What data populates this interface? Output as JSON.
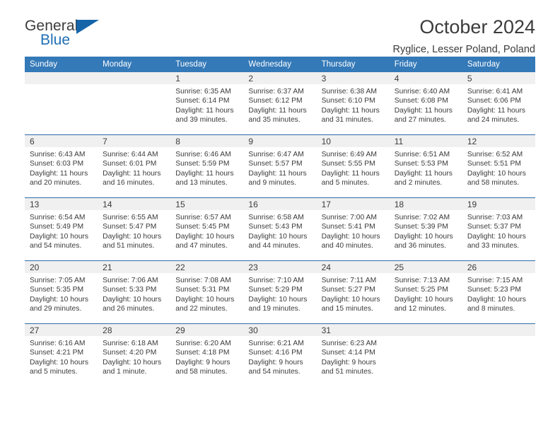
{
  "brand": {
    "line1": "General",
    "line2": "Blue",
    "triangle_color": "#1565a8",
    "blue_color": "#1f6fb5"
  },
  "header": {
    "title": "October 2024",
    "subtitle": "Ryglice, Lesser Poland, Poland"
  },
  "theme": {
    "header_row_bg": "#3479b8",
    "row_divider": "#2f6ca8",
    "daynum_bg": "#f0f0f0",
    "text": "#3b3b3b"
  },
  "calendar": {
    "weekday_headers": [
      "Sunday",
      "Monday",
      "Tuesday",
      "Wednesday",
      "Thursday",
      "Friday",
      "Saturday"
    ],
    "weeks": [
      [
        {
          "day": "",
          "sunrise": "",
          "sunset": "",
          "daylight1": "",
          "daylight2": ""
        },
        {
          "day": "",
          "sunrise": "",
          "sunset": "",
          "daylight1": "",
          "daylight2": ""
        },
        {
          "day": "1",
          "sunrise": "Sunrise: 6:35 AM",
          "sunset": "Sunset: 6:14 PM",
          "daylight1": "Daylight: 11 hours",
          "daylight2": "and 39 minutes."
        },
        {
          "day": "2",
          "sunrise": "Sunrise: 6:37 AM",
          "sunset": "Sunset: 6:12 PM",
          "daylight1": "Daylight: 11 hours",
          "daylight2": "and 35 minutes."
        },
        {
          "day": "3",
          "sunrise": "Sunrise: 6:38 AM",
          "sunset": "Sunset: 6:10 PM",
          "daylight1": "Daylight: 11 hours",
          "daylight2": "and 31 minutes."
        },
        {
          "day": "4",
          "sunrise": "Sunrise: 6:40 AM",
          "sunset": "Sunset: 6:08 PM",
          "daylight1": "Daylight: 11 hours",
          "daylight2": "and 27 minutes."
        },
        {
          "day": "5",
          "sunrise": "Sunrise: 6:41 AM",
          "sunset": "Sunset: 6:06 PM",
          "daylight1": "Daylight: 11 hours",
          "daylight2": "and 24 minutes."
        }
      ],
      [
        {
          "day": "6",
          "sunrise": "Sunrise: 6:43 AM",
          "sunset": "Sunset: 6:03 PM",
          "daylight1": "Daylight: 11 hours",
          "daylight2": "and 20 minutes."
        },
        {
          "day": "7",
          "sunrise": "Sunrise: 6:44 AM",
          "sunset": "Sunset: 6:01 PM",
          "daylight1": "Daylight: 11 hours",
          "daylight2": "and 16 minutes."
        },
        {
          "day": "8",
          "sunrise": "Sunrise: 6:46 AM",
          "sunset": "Sunset: 5:59 PM",
          "daylight1": "Daylight: 11 hours",
          "daylight2": "and 13 minutes."
        },
        {
          "day": "9",
          "sunrise": "Sunrise: 6:47 AM",
          "sunset": "Sunset: 5:57 PM",
          "daylight1": "Daylight: 11 hours",
          "daylight2": "and 9 minutes."
        },
        {
          "day": "10",
          "sunrise": "Sunrise: 6:49 AM",
          "sunset": "Sunset: 5:55 PM",
          "daylight1": "Daylight: 11 hours",
          "daylight2": "and 5 minutes."
        },
        {
          "day": "11",
          "sunrise": "Sunrise: 6:51 AM",
          "sunset": "Sunset: 5:53 PM",
          "daylight1": "Daylight: 11 hours",
          "daylight2": "and 2 minutes."
        },
        {
          "day": "12",
          "sunrise": "Sunrise: 6:52 AM",
          "sunset": "Sunset: 5:51 PM",
          "daylight1": "Daylight: 10 hours",
          "daylight2": "and 58 minutes."
        }
      ],
      [
        {
          "day": "13",
          "sunrise": "Sunrise: 6:54 AM",
          "sunset": "Sunset: 5:49 PM",
          "daylight1": "Daylight: 10 hours",
          "daylight2": "and 54 minutes."
        },
        {
          "day": "14",
          "sunrise": "Sunrise: 6:55 AM",
          "sunset": "Sunset: 5:47 PM",
          "daylight1": "Daylight: 10 hours",
          "daylight2": "and 51 minutes."
        },
        {
          "day": "15",
          "sunrise": "Sunrise: 6:57 AM",
          "sunset": "Sunset: 5:45 PM",
          "daylight1": "Daylight: 10 hours",
          "daylight2": "and 47 minutes."
        },
        {
          "day": "16",
          "sunrise": "Sunrise: 6:58 AM",
          "sunset": "Sunset: 5:43 PM",
          "daylight1": "Daylight: 10 hours",
          "daylight2": "and 44 minutes."
        },
        {
          "day": "17",
          "sunrise": "Sunrise: 7:00 AM",
          "sunset": "Sunset: 5:41 PM",
          "daylight1": "Daylight: 10 hours",
          "daylight2": "and 40 minutes."
        },
        {
          "day": "18",
          "sunrise": "Sunrise: 7:02 AM",
          "sunset": "Sunset: 5:39 PM",
          "daylight1": "Daylight: 10 hours",
          "daylight2": "and 36 minutes."
        },
        {
          "day": "19",
          "sunrise": "Sunrise: 7:03 AM",
          "sunset": "Sunset: 5:37 PM",
          "daylight1": "Daylight: 10 hours",
          "daylight2": "and 33 minutes."
        }
      ],
      [
        {
          "day": "20",
          "sunrise": "Sunrise: 7:05 AM",
          "sunset": "Sunset: 5:35 PM",
          "daylight1": "Daylight: 10 hours",
          "daylight2": "and 29 minutes."
        },
        {
          "day": "21",
          "sunrise": "Sunrise: 7:06 AM",
          "sunset": "Sunset: 5:33 PM",
          "daylight1": "Daylight: 10 hours",
          "daylight2": "and 26 minutes."
        },
        {
          "day": "22",
          "sunrise": "Sunrise: 7:08 AM",
          "sunset": "Sunset: 5:31 PM",
          "daylight1": "Daylight: 10 hours",
          "daylight2": "and 22 minutes."
        },
        {
          "day": "23",
          "sunrise": "Sunrise: 7:10 AM",
          "sunset": "Sunset: 5:29 PM",
          "daylight1": "Daylight: 10 hours",
          "daylight2": "and 19 minutes."
        },
        {
          "day": "24",
          "sunrise": "Sunrise: 7:11 AM",
          "sunset": "Sunset: 5:27 PM",
          "daylight1": "Daylight: 10 hours",
          "daylight2": "and 15 minutes."
        },
        {
          "day": "25",
          "sunrise": "Sunrise: 7:13 AM",
          "sunset": "Sunset: 5:25 PM",
          "daylight1": "Daylight: 10 hours",
          "daylight2": "and 12 minutes."
        },
        {
          "day": "26",
          "sunrise": "Sunrise: 7:15 AM",
          "sunset": "Sunset: 5:23 PM",
          "daylight1": "Daylight: 10 hours",
          "daylight2": "and 8 minutes."
        }
      ],
      [
        {
          "day": "27",
          "sunrise": "Sunrise: 6:16 AM",
          "sunset": "Sunset: 4:21 PM",
          "daylight1": "Daylight: 10 hours",
          "daylight2": "and 5 minutes."
        },
        {
          "day": "28",
          "sunrise": "Sunrise: 6:18 AM",
          "sunset": "Sunset: 4:20 PM",
          "daylight1": "Daylight: 10 hours",
          "daylight2": "and 1 minute."
        },
        {
          "day": "29",
          "sunrise": "Sunrise: 6:20 AM",
          "sunset": "Sunset: 4:18 PM",
          "daylight1": "Daylight: 9 hours",
          "daylight2": "and 58 minutes."
        },
        {
          "day": "30",
          "sunrise": "Sunrise: 6:21 AM",
          "sunset": "Sunset: 4:16 PM",
          "daylight1": "Daylight: 9 hours",
          "daylight2": "and 54 minutes."
        },
        {
          "day": "31",
          "sunrise": "Sunrise: 6:23 AM",
          "sunset": "Sunset: 4:14 PM",
          "daylight1": "Daylight: 9 hours",
          "daylight2": "and 51 minutes."
        },
        {
          "day": "",
          "sunrise": "",
          "sunset": "",
          "daylight1": "",
          "daylight2": ""
        },
        {
          "day": "",
          "sunrise": "",
          "sunset": "",
          "daylight1": "",
          "daylight2": ""
        }
      ]
    ]
  }
}
